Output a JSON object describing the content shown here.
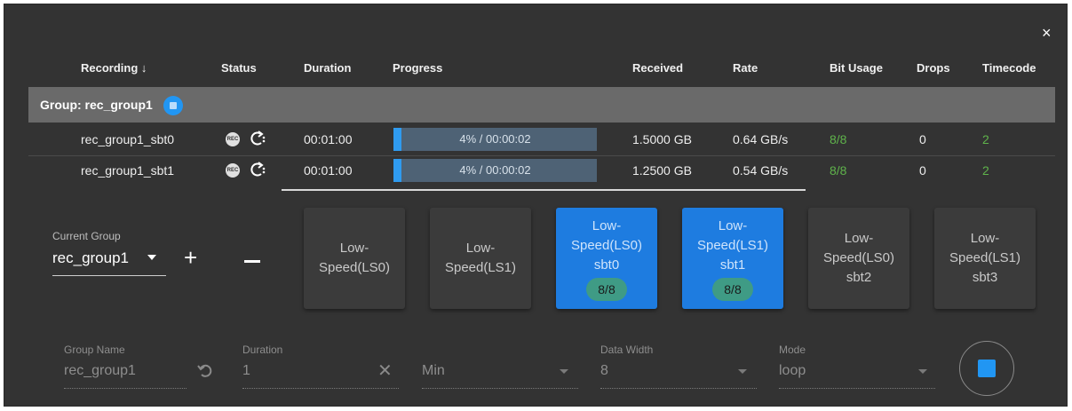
{
  "close_glyph": "×",
  "columns": {
    "recording": "Recording ↓",
    "status": "Status",
    "duration": "Duration",
    "progress": "Progress",
    "received": "Received",
    "rate": "Rate",
    "bit_usage": "Bit Usage",
    "drops": "Drops",
    "timecode": "Timecode"
  },
  "group": {
    "label": "Group: rec_group1"
  },
  "rows": [
    {
      "name": "rec_group1_sbt0",
      "rec_badge": "REC",
      "duration": "00:01:00",
      "progress_fraction": 0.04,
      "progress_text": "4% / 00:00:02",
      "received": "1.5000 GB",
      "rate": "0.64 GB/s",
      "bit_usage": "8/8",
      "drops": "0",
      "timecode": "2"
    },
    {
      "name": "rec_group1_sbt1",
      "rec_badge": "REC",
      "duration": "00:01:00",
      "progress_fraction": 0.04,
      "progress_text": "4% / 00:00:02",
      "received": "1.2500 GB",
      "rate": "0.54 GB/s",
      "bit_usage": "8/8",
      "drops": "0",
      "timecode": "2"
    }
  ],
  "controls": {
    "current_group_label": "Current Group",
    "current_group_value": "rec_group1",
    "add_glyph": "+"
  },
  "tiles": [
    {
      "line1": "Low-",
      "line2": "Speed(LS0)",
      "line3": "",
      "badge": "",
      "selected": false
    },
    {
      "line1": "Low-",
      "line2": "Speed(LS1)",
      "line3": "",
      "badge": "",
      "selected": false
    },
    {
      "line1": "Low-",
      "line2": "Speed(LS0)",
      "line3": "sbt0",
      "badge": "8/8",
      "selected": true
    },
    {
      "line1": "Low-",
      "line2": "Speed(LS1)",
      "line3": "sbt1",
      "badge": "8/8",
      "selected": true
    },
    {
      "line1": "Low-",
      "line2": "Speed(LS0)",
      "line3": "sbt2",
      "badge": "",
      "selected": false
    },
    {
      "line1": "Low-",
      "line2": "Speed(LS1)",
      "line3": "sbt3",
      "badge": "",
      "selected": false
    }
  ],
  "form": {
    "group_name_label": "Group Name",
    "group_name_value": "rec_group1",
    "duration_label": "Duration",
    "duration_value": "1",
    "clear_glyph": "✕",
    "unit_value": "Min",
    "data_width_label": "Data Width",
    "data_width_value": "8",
    "mode_label": "Mode",
    "mode_value": "loop"
  },
  "colors": {
    "panel_bg": "#333333",
    "group_row_bg": "#6a6a6a",
    "accent_blue": "#2196f3",
    "selected_tile": "#1e7ce0",
    "bit_usage_green": "#5fb34b",
    "badge_teal": "#3f9b85"
  }
}
